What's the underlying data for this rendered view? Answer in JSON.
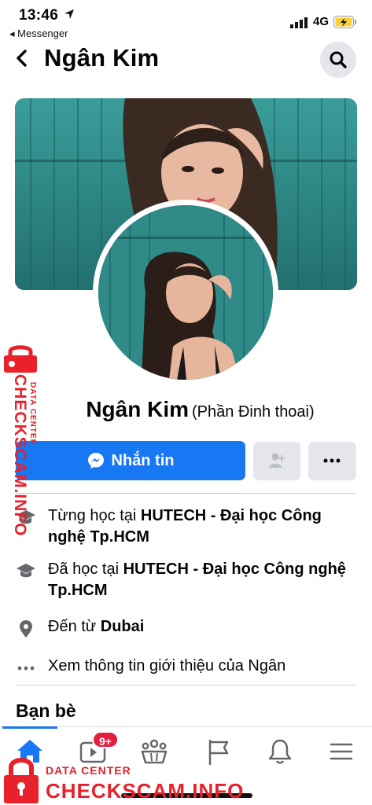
{
  "status_bar": {
    "time": "13:46",
    "back_app": "◂ Messenger",
    "network": "4G"
  },
  "header": {
    "title": "Ngân Kim"
  },
  "profile": {
    "name": "Ngân Kim",
    "alternate_name": "(Phần Đinh thoai)"
  },
  "actions": {
    "message_label": "Nhắn tin"
  },
  "info_rows": [
    {
      "icon": "graduation-cap-icon",
      "prefix": "Từng học tại ",
      "bold": "HUTECH - Đại học Công nghệ Tp.HCM",
      "suffix": ""
    },
    {
      "icon": "graduation-cap-icon",
      "prefix": "Đã học tại ",
      "bold": "HUTECH - Đại học Công nghệ Tp.HCM",
      "suffix": ""
    },
    {
      "icon": "location-pin-icon",
      "prefix": "Đến từ ",
      "bold": "Dubai",
      "suffix": ""
    },
    {
      "icon": "more-dots-icon",
      "prefix": "Xem thông tin giới thiệu của Ngân",
      "bold": "",
      "suffix": ""
    }
  ],
  "friends_title": "Bạn bè",
  "tabbar": {
    "video_badge": "9+",
    "tabs": [
      "home-icon",
      "video-icon",
      "groups-icon",
      "pages-flag-icon",
      "notifications-bell-icon",
      "menu-icon"
    ]
  },
  "watermark": {
    "side_main": "CHECKSCAM.INFO",
    "side_sub": "DATA CENTER",
    "bottom_sub": "DATA CENTER",
    "bottom_main": "CHECKSCAM.INFO"
  },
  "colors": {
    "brand_blue": "#1877f2",
    "button_grey": "#e4e6eb",
    "badge_red": "#e41e3f",
    "watermark_red": "#e8212b"
  }
}
